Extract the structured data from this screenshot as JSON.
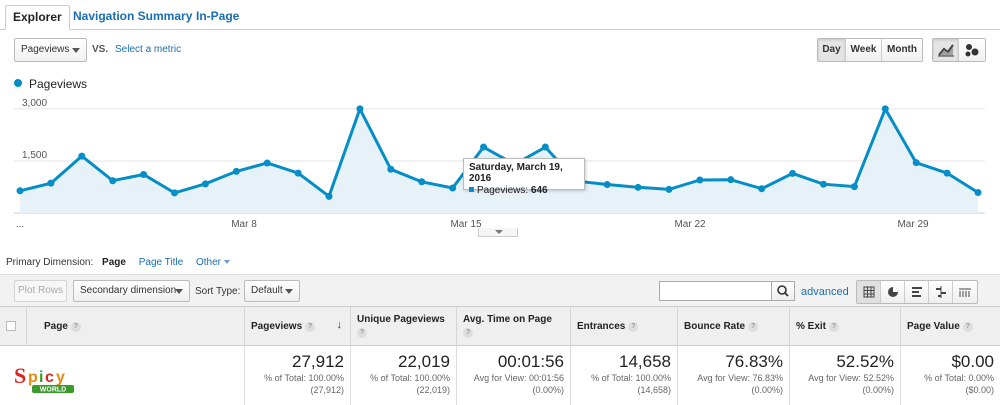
{
  "tabs": [
    "Explorer",
    "Navigation Summary",
    "In-Page"
  ],
  "toolbar": {
    "metric": "Pageviews",
    "vs": "VS.",
    "select_metric": "Select a metric",
    "periods": [
      "Day",
      "Week",
      "Month"
    ],
    "selected_period": "Day"
  },
  "legend": {
    "label": "Pageviews"
  },
  "chart_data": {
    "type": "area",
    "series": [
      {
        "name": "Pageviews",
        "values": [
          640,
          860,
          1640,
          930,
          1110,
          580,
          840,
          1200,
          1440,
          1150,
          480,
          3000,
          1260,
          900,
          720,
          1900,
          1400,
          1900,
          920,
          820,
          740,
          680,
          950,
          960,
          700,
          1140,
          830,
          760,
          3000,
          1450,
          1150,
          590
        ]
      }
    ],
    "x_tick_labels": [
      "...",
      "Mar 8",
      "Mar 15",
      "Mar 22",
      "Mar 29"
    ],
    "y_tick_labels": [
      "3,000",
      "1,500"
    ],
    "ylim": [
      0,
      3400
    ],
    "color": "#058dc7",
    "fill_color": "#e6f2f8"
  },
  "tooltip": {
    "date": "Saturday, March 19, 2016",
    "label": "Pageviews:",
    "value": "646"
  },
  "primary_dimension": {
    "label": "Primary Dimension:",
    "current": "Page",
    "links": [
      "Page Title",
      "Other"
    ]
  },
  "table_toolbar": {
    "plot_rows": "Plot Rows",
    "secondary_dimension": "Secondary dimension",
    "sort_type_label": "Sort Type:",
    "sort_type": "Default",
    "advanced": "advanced"
  },
  "table": {
    "headers": [
      "Page",
      "Pageviews",
      "Unique Pageviews",
      "Avg. Time on Page",
      "Entrances",
      "Bounce Rate",
      "% Exit",
      "Page Value"
    ],
    "summary": [
      {
        "value": "27,912",
        "sub1": "% of Total: 100.00%",
        "sub2": "(27,912)"
      },
      {
        "value": "22,019",
        "sub1": "% of Total: 100.00%",
        "sub2": "(22,019)"
      },
      {
        "value": "00:01:56",
        "sub1": "Avg for View: 00:01:56",
        "sub2": "(0.00%)"
      },
      {
        "value": "14,658",
        "sub1": "% of Total: 100.00%",
        "sub2": "(14,658)"
      },
      {
        "value": "76.83%",
        "sub1": "Avg for View: 76.83%",
        "sub2": "(0.00%)"
      },
      {
        "value": "52.52%",
        "sub1": "Avg for View: 52.52%",
        "sub2": "(0.00%)"
      },
      {
        "value": "$0.00",
        "sub1": "% of Total: 0.00%",
        "sub2": "($0.00)"
      }
    ]
  },
  "logo": {
    "text": "Spicy",
    "sub": "WORLD"
  }
}
